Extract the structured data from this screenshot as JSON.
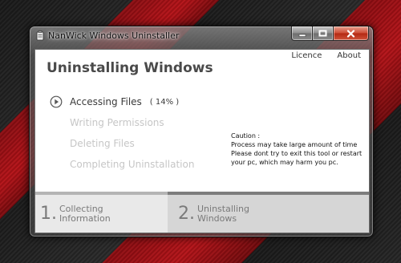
{
  "window": {
    "title": "NanWick Windows Uninstaller",
    "controls": [
      "minimize-icon",
      "maximize-icon",
      "close-icon"
    ]
  },
  "top_links": {
    "licence": "Licence",
    "about": "About"
  },
  "page_title": "Uninstalling Windows",
  "steps": {
    "active": {
      "label": "Accessing Files",
      "percent": "( 14% )",
      "progress": 0.14,
      "icon": "play-circle-icon"
    },
    "pending": [
      "Writing Permissions",
      "Deleting Files",
      "Completing Uninstallation"
    ]
  },
  "caution": {
    "heading": "Caution :",
    "lines": [
      "Process may take large amount of time",
      "Please dont try to exit this tool or restart",
      " your pc, which may harm you pc."
    ]
  },
  "wizard": [
    {
      "number": "1.",
      "line1": "Collecting",
      "line2": "Information"
    },
    {
      "number": "2.",
      "line1": "Uninstalling",
      "line2": "Windows"
    }
  ],
  "colors": {
    "background_dark": "#1f1f1f",
    "background_red": "#b51217",
    "close_button": "#c73d25",
    "pending_text": "#c6c6c6"
  }
}
